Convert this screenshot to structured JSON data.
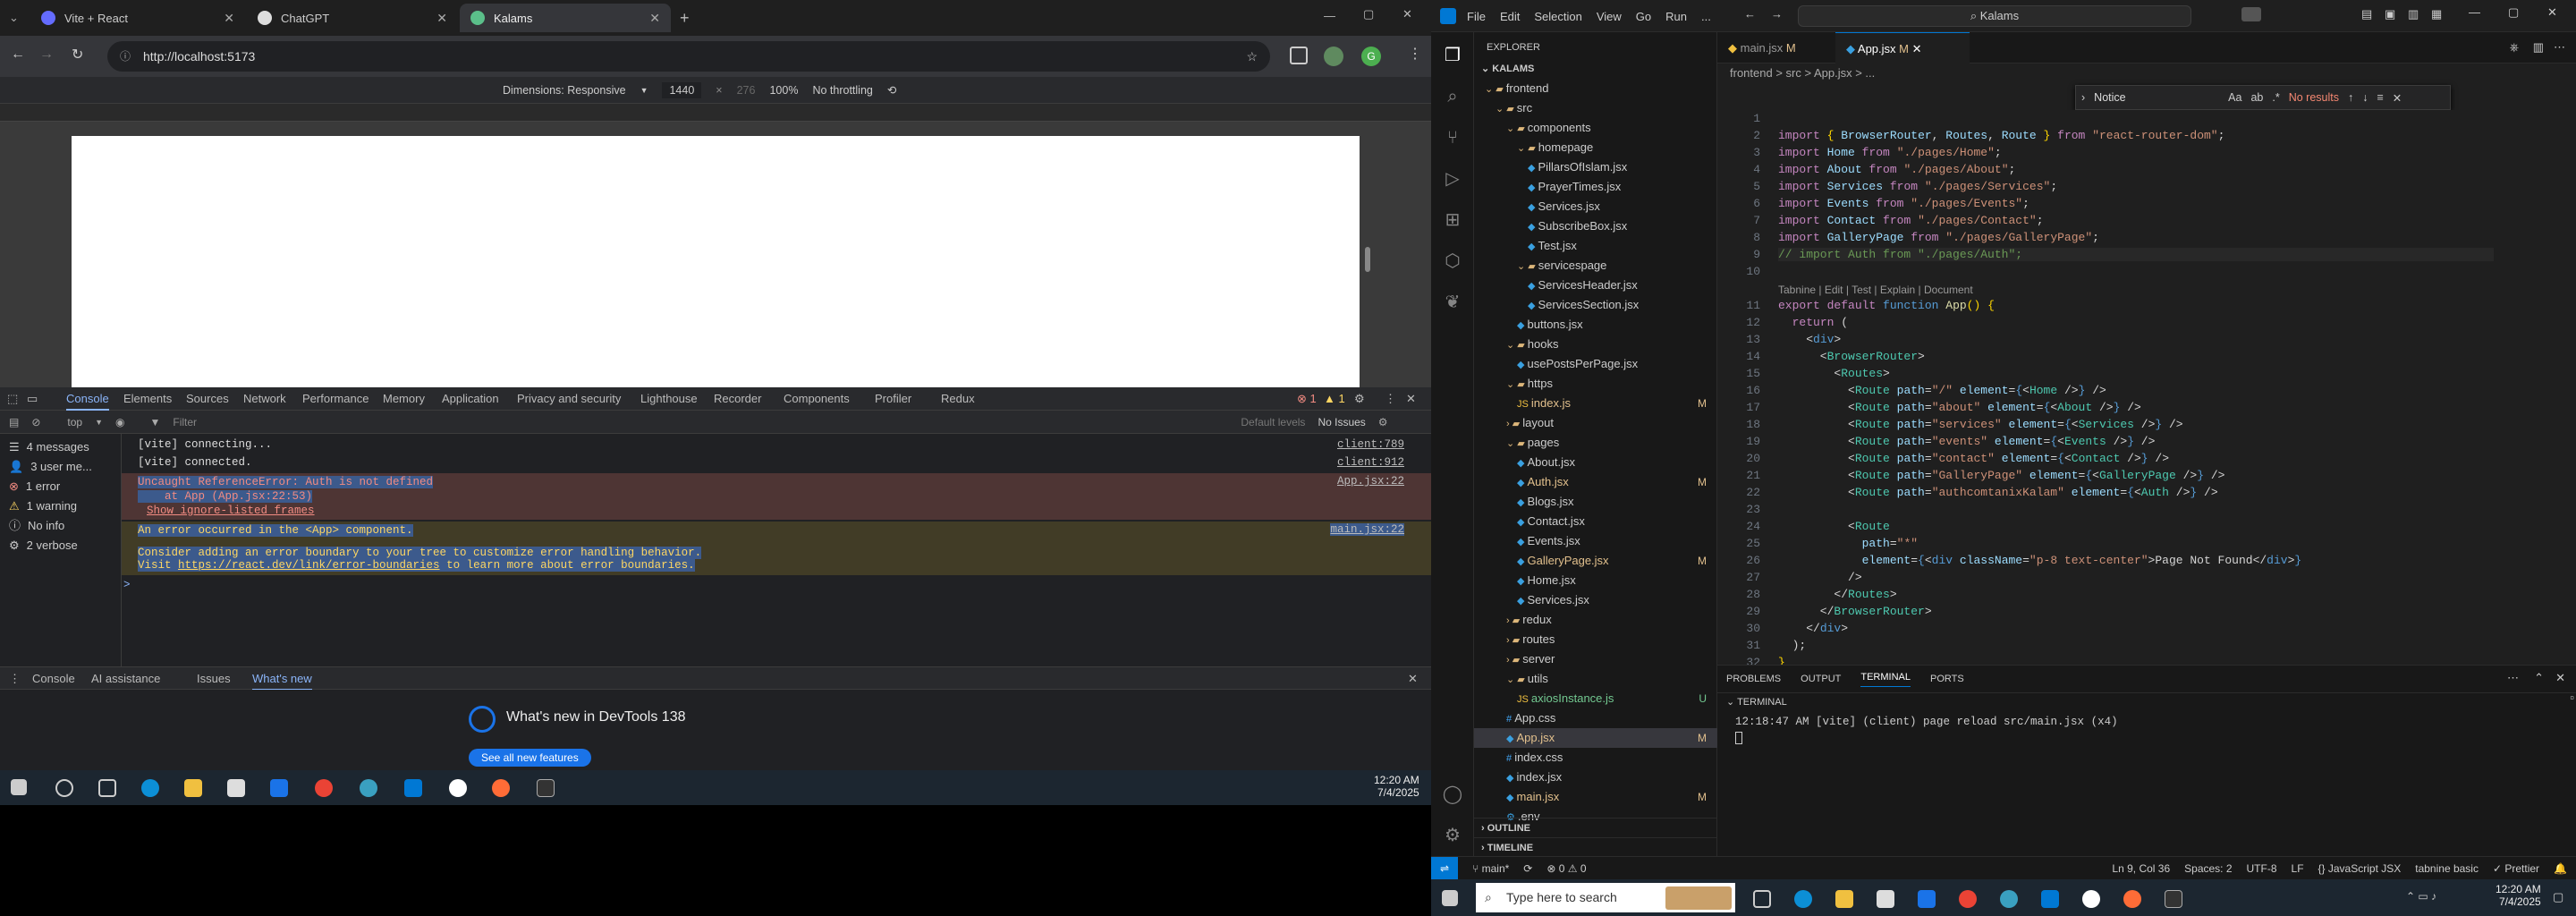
{
  "chrome": {
    "tabs": [
      {
        "label": "Vite + React"
      },
      {
        "label": "ChatGPT"
      },
      {
        "label": "Kalams"
      }
    ],
    "url": "http://localhost:5173",
    "device": {
      "dimensions": "Dimensions: Responsive",
      "width": "1440",
      "height": "276",
      "zoom": "100%",
      "throttle": "No throttling"
    },
    "devtools_tabs": [
      "Console",
      "Elements",
      "Sources",
      "Network",
      "Performance",
      "Memory",
      "Application",
      "Privacy and security",
      "Lighthouse",
      "Recorder",
      "Components",
      "Profiler",
      "Redux"
    ],
    "errors_badge": "1",
    "warn_badge": "1",
    "filter": {
      "context": "top",
      "placeholder": "Filter",
      "levels": "Default levels",
      "issues": "No Issues"
    },
    "sidebar": [
      {
        "label": "4 messages"
      },
      {
        "label": "3 user me..."
      },
      {
        "label": "1 error"
      },
      {
        "label": "1 warning"
      },
      {
        "label": "No info"
      },
      {
        "label": "2 verbose"
      }
    ],
    "console": {
      "l1": "[vite] connecting...",
      "l1src": "client:789",
      "l2": "[vite] connected.",
      "l2src": "client:912",
      "e1": "Uncaught ReferenceError: Auth is not defined",
      "e1b": "    at App (App.jsx:22:53)",
      "e1src": "App.jsx:22",
      "e1c": "Show ignore-listed frames",
      "w1": "An error occurred in the <App> component.",
      "w1src": "main.jsx:22",
      "w2": "Consider adding an error boundary to your tree to customize error handling behavior.",
      "w3a": "Visit ",
      "w3link": "https://react.dev/link/error-boundaries",
      "w3b": " to learn more about error boundaries.",
      "prompt": ">"
    },
    "drawer_tabs": [
      "Console",
      "AI assistance",
      "Issues",
      "What's new"
    ],
    "whatsnew": {
      "title": "What's new in DevTools 138",
      "button": "See all new features"
    },
    "clock": {
      "time": "12:20 AM",
      "date": "7/4/2025"
    }
  },
  "vscode": {
    "menu": [
      "File",
      "Edit",
      "Selection",
      "View",
      "Go",
      "Run",
      "..."
    ],
    "search": "Kalams",
    "explorer_title": "EXPLORER",
    "root": "KALAMS",
    "tree": [
      {
        "label": "frontend"
      },
      {
        "label": "src"
      },
      {
        "label": "components"
      },
      {
        "label": "homepage"
      },
      {
        "label": "PillarsOfIslam.jsx"
      },
      {
        "label": "PrayerTimes.jsx"
      },
      {
        "label": "Services.jsx"
      },
      {
        "label": "SubscribeBox.jsx"
      },
      {
        "label": "Test.jsx"
      },
      {
        "label": "servicespage"
      },
      {
        "label": "ServicesHeader.jsx"
      },
      {
        "label": "ServicesSection.jsx"
      },
      {
        "label": "buttons.jsx"
      },
      {
        "label": "hooks"
      },
      {
        "label": "usePostsPerPage.jsx"
      },
      {
        "label": "https"
      },
      {
        "label": "index.js",
        "badge": "M"
      },
      {
        "label": "layout"
      },
      {
        "label": "pages"
      },
      {
        "label": "About.jsx"
      },
      {
        "label": "Auth.jsx",
        "badge": "M"
      },
      {
        "label": "Blogs.jsx"
      },
      {
        "label": "Contact.jsx"
      },
      {
        "label": "Events.jsx"
      },
      {
        "label": "GalleryPage.jsx",
        "badge": "M"
      },
      {
        "label": "Home.jsx"
      },
      {
        "label": "Services.jsx"
      },
      {
        "label": "redux"
      },
      {
        "label": "routes"
      },
      {
        "label": "server"
      },
      {
        "label": "utils"
      },
      {
        "label": "axiosInstance.js",
        "badge": "U"
      },
      {
        "label": "App.css"
      },
      {
        "label": "App.jsx",
        "badge": "M"
      },
      {
        "label": "index.css"
      },
      {
        "label": "index.jsx"
      },
      {
        "label": "main.jsx",
        "badge": "M"
      },
      {
        "label": ".env"
      }
    ],
    "outline": "OUTLINE",
    "timeline": "TIMELINE",
    "tabs": [
      {
        "label": "main.jsx",
        "badge": "M"
      },
      {
        "label": "App.jsx",
        "badge": "M"
      }
    ],
    "breadcrumb": "frontend > src > App.jsx > ...",
    "find": {
      "value": "Notice",
      "result": "No results"
    },
    "lens": "Tabnine | Edit | Test | Explain | Document",
    "panel_tabs": [
      "PROBLEMS",
      "OUTPUT",
      "TERMINAL",
      "PORTS"
    ],
    "terminal_label": "TERMINAL",
    "terminal_line": "12:18:47 AM [vite] (client) page reload src/main.jsx (x4)",
    "status": {
      "branch": "main*",
      "problems": "⊗ 0 ⚠ 0",
      "pos": "Ln 9, Col 36",
      "spaces": "Spaces: 2",
      "enc": "UTF-8",
      "eol": "LF",
      "lang": "{} JavaScript JSX",
      "tabnine": "tabnine basic",
      "prettier": "✓ Prettier"
    }
  },
  "taskbar": {
    "search": "Type here to search",
    "time": "12:20 AM",
    "date": "7/4/2025"
  },
  "colors": {
    "accent": "#0078d4",
    "error": "#f28b82",
    "warn": "#fdd663"
  }
}
